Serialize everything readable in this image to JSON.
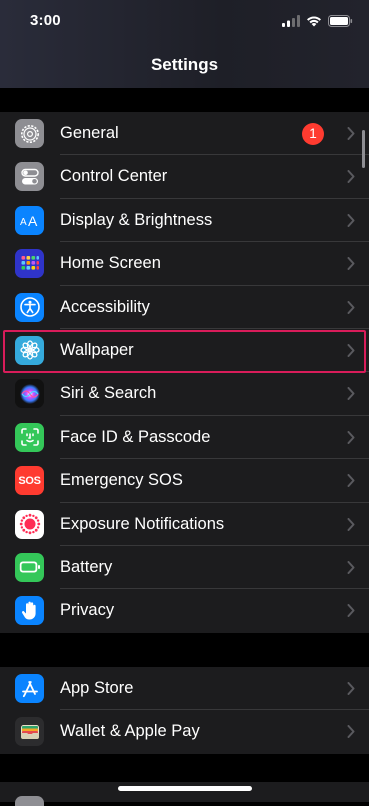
{
  "status": {
    "time": "3:00"
  },
  "nav": {
    "title": "Settings"
  },
  "group1": [
    {
      "id": "general",
      "label": "General",
      "icon": "gear-icon",
      "color": "#8e8e93",
      "badge": "1"
    },
    {
      "id": "control-center",
      "label": "Control Center",
      "icon": "toggles-icon",
      "color": "#8e8e93"
    },
    {
      "id": "display-brightness",
      "label": "Display & Brightness",
      "icon": "text-size-icon",
      "color": "#0a84ff"
    },
    {
      "id": "home-screen",
      "label": "Home Screen",
      "icon": "app-grid-icon",
      "color": "#2f34c9"
    },
    {
      "id": "accessibility",
      "label": "Accessibility",
      "icon": "accessibility-icon",
      "color": "#0a84ff"
    },
    {
      "id": "wallpaper",
      "label": "Wallpaper",
      "icon": "flower-icon",
      "color": "#35aadc"
    },
    {
      "id": "siri-search",
      "label": "Siri & Search",
      "icon": "siri-icon",
      "color": "#111111"
    },
    {
      "id": "face-id-passcode",
      "label": "Face ID & Passcode",
      "icon": "face-id-icon",
      "color": "#34c759"
    },
    {
      "id": "emergency-sos",
      "label": "Emergency SOS",
      "icon": "sos-icon",
      "color": "#ff3b30",
      "icon_text": "SOS"
    },
    {
      "id": "exposure-notifications",
      "label": "Exposure Notifications",
      "icon": "exposure-icon",
      "color": "#ffffff"
    },
    {
      "id": "battery",
      "label": "Battery",
      "icon": "battery-icon",
      "color": "#34c759"
    },
    {
      "id": "privacy",
      "label": "Privacy",
      "icon": "hand-icon",
      "color": "#0a84ff"
    }
  ],
  "group2": [
    {
      "id": "app-store",
      "label": "App Store",
      "icon": "app-store-icon",
      "color": "#0a84ff"
    },
    {
      "id": "wallet-apple-pay",
      "label": "Wallet & Apple Pay",
      "icon": "wallet-icon",
      "color": "#1c1c1e"
    }
  ],
  "highlighted_item": "wallpaper"
}
